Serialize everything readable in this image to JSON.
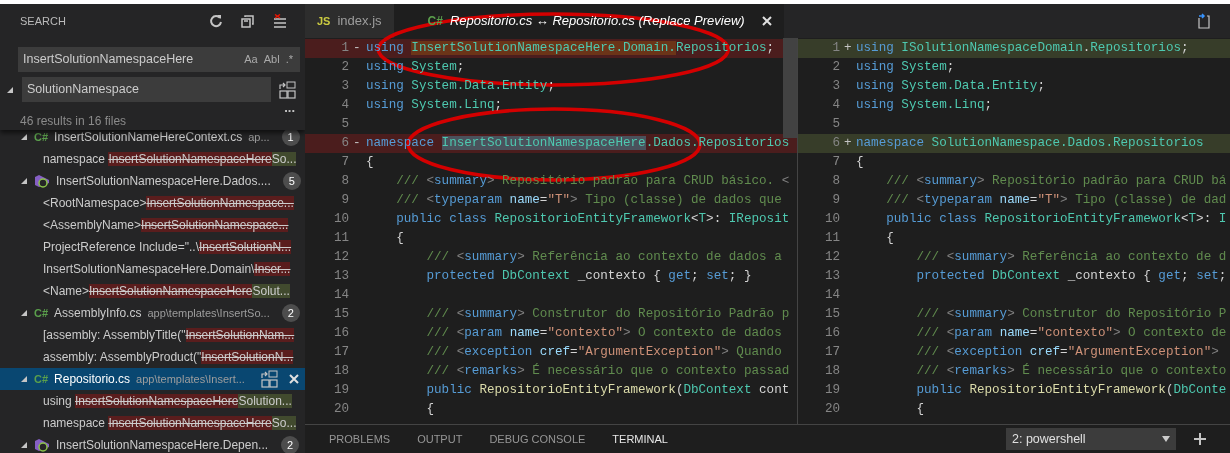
{
  "sidebar": {
    "title": "SEARCH",
    "find": {
      "value": "InsertSolutionNamespaceHere",
      "options": [
        "Aa",
        "Abl",
        ".*"
      ]
    },
    "replace": {
      "value": "SolutionNamespace",
      "expanded": true
    },
    "more": "...",
    "summary": "46 results in 16 files",
    "files": [
      {
        "kind": "csharp",
        "icon": "C#",
        "name": "InsertSolutionNameHereContext.cs",
        "path": "ap...",
        "count": "1",
        "expanded": true,
        "selected": false,
        "matches": [
          {
            "before": "namespace ",
            "removed": "InsertSolutionNamespaceHere",
            "added": "So..."
          }
        ]
      },
      {
        "kind": "project",
        "name": "InsertSolutionNamespaceHere.Dados....",
        "count": "5",
        "expanded": true,
        "selected": false,
        "matches": [
          {
            "before": "<RootNamespace>",
            "removed": "InsertSolutionNamespace..."
          },
          {
            "before": "<AssemblyName>",
            "removed": "InsertSolutionNamespace..."
          },
          {
            "before": "ProjectReference Include=\"..\\",
            "removed": "InsertSolutionN..."
          },
          {
            "before": "InsertSolutionNamespaceHere.Domain\\",
            "removed": "Inser..."
          },
          {
            "before": "<Name>",
            "removed": "InsertSolutionNamespaceHere",
            "added": "Solut..."
          }
        ]
      },
      {
        "kind": "csharp",
        "icon": "C#",
        "name": "AssemblyInfo.cs",
        "path": "app\\templates\\InsertSo...",
        "count": "2",
        "expanded": true,
        "selected": false,
        "matches": [
          {
            "before": "[assembly: AssemblyTitle(\"",
            "removed": "InsertSolutionNam..."
          },
          {
            "before": "assembly: AssemblyProduct(\"",
            "removed": "InsertSolutionN..."
          }
        ]
      },
      {
        "kind": "csharp",
        "icon": "C#",
        "name": "Repositorio.cs",
        "path": "app\\templates\\Insert...",
        "expanded": true,
        "selected": true,
        "matches": [
          {
            "before": "using ",
            "removed": "InsertSolutionNamespaceHere",
            "added": "Solution..."
          },
          {
            "before": "namespace ",
            "removed": "InsertSolutionNamespaceHere",
            "added": "So..."
          }
        ]
      },
      {
        "kind": "project",
        "name": "InsertSolutionNamespaceHere.Depen...",
        "count": "2",
        "expanded": true,
        "selected": false
      }
    ]
  },
  "tabs": [
    {
      "kind": "js",
      "icon": "JS",
      "label": "index.js",
      "selected": false,
      "preview": false
    },
    {
      "kind": "csharp",
      "icon": "C#",
      "label": "Repositorio.cs ↔ Repositorio.cs (Replace Preview)",
      "selected": true,
      "preview": true
    }
  ],
  "left_pane": {
    "lines": [
      {
        "number": "1",
        "marker": "-",
        "kind": "removed",
        "tokens": [
          {
            "text": "using ",
            "kind": "kw"
          },
          {
            "text": "InsertSolutionNamespaceHere.Domain.",
            "kind": "type",
            "changed": true,
            "circled": true
          },
          {
            "text": "Repositorios",
            "kind": "type"
          },
          {
            "text": ";",
            "kind": "plain"
          }
        ]
      },
      {
        "number": "2",
        "kind": "context",
        "tokens": [
          {
            "text": "using ",
            "kind": "kw"
          },
          {
            "text": "System",
            "kind": "type"
          },
          {
            "text": ";",
            "kind": "plain"
          }
        ]
      },
      {
        "number": "3",
        "kind": "context",
        "tokens": [
          {
            "text": "using ",
            "kind": "kw"
          },
          {
            "text": "System.Data.Entity",
            "kind": "type"
          },
          {
            "text": ";",
            "kind": "plain"
          }
        ]
      },
      {
        "number": "4",
        "kind": "context",
        "tokens": [
          {
            "text": "using ",
            "kind": "kw"
          },
          {
            "text": "System.Linq",
            "kind": "type"
          },
          {
            "text": ";",
            "kind": "plain"
          }
        ]
      },
      {
        "number": "5",
        "kind": "context"
      },
      {
        "number": "6",
        "marker": "-",
        "kind": "removed",
        "tokens": [
          {
            "text": "namespace ",
            "kind": "kw"
          },
          {
            "text": "InsertSolutionNamespaceHere",
            "kind": "type",
            "selected": true,
            "circled": true
          },
          {
            "text": ".Dados.Repositorios",
            "kind": "type"
          }
        ]
      },
      {
        "number": "7",
        "kind": "context",
        "tokens": [
          {
            "text": "{",
            "kind": "plain"
          }
        ]
      },
      {
        "number": "8",
        "kind": "context",
        "tokens": [
          {
            "text": "    ///",
            "kind": "comment"
          },
          {
            "text": " <",
            "kind": "delim"
          },
          {
            "text": "summary",
            "kind": "tag"
          },
          {
            "text": ">",
            "kind": "delim"
          },
          {
            "text": " Repositório padrão para CRUD básico. ",
            "kind": "comment"
          },
          {
            "text": "<",
            "kind": "delim"
          }
        ]
      },
      {
        "number": "9",
        "kind": "context",
        "tokens": [
          {
            "text": "    ///",
            "kind": "comment"
          },
          {
            "text": " <",
            "kind": "delim"
          },
          {
            "text": "typeparam ",
            "kind": "tag"
          },
          {
            "text": "name",
            "kind": "attr"
          },
          {
            "text": "=",
            "kind": "plain"
          },
          {
            "text": "\"T\"",
            "kind": "str"
          },
          {
            "text": ">",
            "kind": "delim"
          },
          {
            "text": " Tipo (classe) de dados que",
            "kind": "comment"
          }
        ]
      },
      {
        "number": "10",
        "kind": "context",
        "tokens": [
          {
            "text": "    public class ",
            "kind": "kw"
          },
          {
            "text": "RepositorioEntityFramework",
            "kind": "type"
          },
          {
            "text": "<",
            "kind": "plain"
          },
          {
            "text": "T",
            "kind": "type"
          },
          {
            "text": ">: ",
            "kind": "plain"
          },
          {
            "text": "IReposit",
            "kind": "type"
          }
        ]
      },
      {
        "number": "11",
        "kind": "context",
        "tokens": [
          {
            "text": "    {",
            "kind": "plain"
          }
        ]
      },
      {
        "number": "12",
        "kind": "context",
        "tokens": [
          {
            "text": "        ///",
            "kind": "comment"
          },
          {
            "text": " <",
            "kind": "delim"
          },
          {
            "text": "summary",
            "kind": "tag"
          },
          {
            "text": ">",
            "kind": "delim"
          },
          {
            "text": " Referência ao contexto de dados a",
            "kind": "comment"
          }
        ]
      },
      {
        "number": "13",
        "kind": "context",
        "tokens": [
          {
            "text": "        protected ",
            "kind": "kw"
          },
          {
            "text": "DbContext",
            "kind": "type"
          },
          {
            "text": " _contexto { ",
            "kind": "plain"
          },
          {
            "text": "get",
            "kind": "kw"
          },
          {
            "text": "; ",
            "kind": "plain"
          },
          {
            "text": "set",
            "kind": "kw"
          },
          {
            "text": "; }",
            "kind": "plain"
          }
        ]
      },
      {
        "number": "14",
        "kind": "context"
      },
      {
        "number": "15",
        "kind": "context",
        "tokens": [
          {
            "text": "        ///",
            "kind": "comment"
          },
          {
            "text": " <",
            "kind": "delim"
          },
          {
            "text": "summary",
            "kind": "tag"
          },
          {
            "text": ">",
            "kind": "delim"
          },
          {
            "text": " Construtor do Repositório Padrão p",
            "kind": "comment"
          }
        ]
      },
      {
        "number": "16",
        "kind": "context",
        "tokens": [
          {
            "text": "        ///",
            "kind": "comment"
          },
          {
            "text": " <",
            "kind": "delim"
          },
          {
            "text": "param ",
            "kind": "tag"
          },
          {
            "text": "name",
            "kind": "attr"
          },
          {
            "text": "=",
            "kind": "plain"
          },
          {
            "text": "\"contexto\"",
            "kind": "str"
          },
          {
            "text": ">",
            "kind": "delim"
          },
          {
            "text": " O contexto de dados",
            "kind": "comment"
          }
        ]
      },
      {
        "number": "17",
        "kind": "context",
        "tokens": [
          {
            "text": "        ///",
            "kind": "comment"
          },
          {
            "text": " <",
            "kind": "delim"
          },
          {
            "text": "exception ",
            "kind": "tag"
          },
          {
            "text": "cref",
            "kind": "attr"
          },
          {
            "text": "=",
            "kind": "plain"
          },
          {
            "text": "\"ArgumentException\"",
            "kind": "str"
          },
          {
            "text": ">",
            "kind": "delim"
          },
          {
            "text": " Quando",
            "kind": "comment"
          }
        ]
      },
      {
        "number": "18",
        "kind": "context",
        "tokens": [
          {
            "text": "        ///",
            "kind": "comment"
          },
          {
            "text": " <",
            "kind": "delim"
          },
          {
            "text": "remarks",
            "kind": "tag"
          },
          {
            "text": ">",
            "kind": "delim"
          },
          {
            "text": " É necessário que o contexto passad",
            "kind": "comment"
          }
        ]
      },
      {
        "number": "19",
        "kind": "context",
        "tokens": [
          {
            "text": "        public ",
            "kind": "kw"
          },
          {
            "text": "RepositorioEntityFramework",
            "kind": "fn"
          },
          {
            "text": "(",
            "kind": "plain"
          },
          {
            "text": "DbContext",
            "kind": "type"
          },
          {
            "text": " cont",
            "kind": "plain"
          }
        ]
      },
      {
        "number": "20",
        "kind": "context",
        "tokens": [
          {
            "text": "        {",
            "kind": "plain"
          }
        ]
      }
    ]
  },
  "right_pane": {
    "lines": [
      {
        "number": "1",
        "marker": "+",
        "kind": "added",
        "tokens": [
          {
            "text": "using ",
            "kind": "kw"
          },
          {
            "text": "ISolutionNamespaceDomain",
            "kind": "type"
          },
          {
            "text": ".",
            "kind": "plain"
          },
          {
            "text": "Repositorios",
            "kind": "type"
          },
          {
            "text": ";",
            "kind": "plain"
          }
        ]
      },
      {
        "number": "2",
        "kind": "context",
        "tokens": [
          {
            "text": "using ",
            "kind": "kw"
          },
          {
            "text": "System",
            "kind": "type"
          },
          {
            "text": ";",
            "kind": "plain"
          }
        ]
      },
      {
        "number": "3",
        "kind": "context",
        "tokens": [
          {
            "text": "using ",
            "kind": "kw"
          },
          {
            "text": "System.Data.Entity",
            "kind": "type"
          },
          {
            "text": ";",
            "kind": "plain"
          }
        ]
      },
      {
        "number": "4",
        "kind": "context",
        "tokens": [
          {
            "text": "using ",
            "kind": "kw"
          },
          {
            "text": "System.Linq",
            "kind": "type"
          },
          {
            "text": ";",
            "kind": "plain"
          }
        ]
      },
      {
        "number": "5",
        "kind": "context"
      },
      {
        "number": "6",
        "marker": "+",
        "kind": "added",
        "tokens": [
          {
            "text": "namespace ",
            "kind": "kw"
          },
          {
            "text": "SolutionNamespace.Dados.Repositorios",
            "kind": "type"
          }
        ]
      },
      {
        "number": "7",
        "kind": "context",
        "tokens": [
          {
            "text": "{",
            "kind": "plain"
          }
        ]
      },
      {
        "number": "8",
        "kind": "context",
        "tokens": [
          {
            "text": "    ///",
            "kind": "comment"
          },
          {
            "text": " <",
            "kind": "delim"
          },
          {
            "text": "summary",
            "kind": "tag"
          },
          {
            "text": ">",
            "kind": "delim"
          },
          {
            "text": " Repositório padrão para CRUD bá",
            "kind": "comment"
          }
        ]
      },
      {
        "number": "9",
        "kind": "context",
        "tokens": [
          {
            "text": "    ///",
            "kind": "comment"
          },
          {
            "text": " <",
            "kind": "delim"
          },
          {
            "text": "typeparam ",
            "kind": "tag"
          },
          {
            "text": "name",
            "kind": "attr"
          },
          {
            "text": "=",
            "kind": "plain"
          },
          {
            "text": "\"T\"",
            "kind": "str"
          },
          {
            "text": ">",
            "kind": "delim"
          },
          {
            "text": " Tipo (classe) de dad",
            "kind": "comment"
          }
        ]
      },
      {
        "number": "10",
        "kind": "context",
        "tokens": [
          {
            "text": "    public class ",
            "kind": "kw"
          },
          {
            "text": "RepositorioEntityFramework",
            "kind": "type"
          },
          {
            "text": "<",
            "kind": "plain"
          },
          {
            "text": "T",
            "kind": "type"
          },
          {
            "text": ">: ",
            "kind": "plain"
          },
          {
            "text": "I",
            "kind": "type"
          }
        ]
      },
      {
        "number": "11",
        "kind": "context",
        "tokens": [
          {
            "text": "    {",
            "kind": "plain"
          }
        ]
      },
      {
        "number": "12",
        "kind": "context",
        "tokens": [
          {
            "text": "        ///",
            "kind": "comment"
          },
          {
            "text": " <",
            "kind": "delim"
          },
          {
            "text": "summary",
            "kind": "tag"
          },
          {
            "text": ">",
            "kind": "delim"
          },
          {
            "text": " Referência ao contexto de d",
            "kind": "comment"
          }
        ]
      },
      {
        "number": "13",
        "kind": "context",
        "tokens": [
          {
            "text": "        protected ",
            "kind": "kw"
          },
          {
            "text": "DbContext",
            "kind": "type"
          },
          {
            "text": " _contexto { ",
            "kind": "plain"
          },
          {
            "text": "get",
            "kind": "kw"
          },
          {
            "text": "; ",
            "kind": "plain"
          },
          {
            "text": "set",
            "kind": "kw"
          },
          {
            "text": ";",
            "kind": "plain"
          }
        ]
      },
      {
        "number": "14",
        "kind": "context"
      },
      {
        "number": "15",
        "kind": "context",
        "tokens": [
          {
            "text": "        ///",
            "kind": "comment"
          },
          {
            "text": " <",
            "kind": "delim"
          },
          {
            "text": "summary",
            "kind": "tag"
          },
          {
            "text": ">",
            "kind": "delim"
          },
          {
            "text": " Construtor do Repositório P",
            "kind": "comment"
          }
        ]
      },
      {
        "number": "16",
        "kind": "context",
        "tokens": [
          {
            "text": "        ///",
            "kind": "comment"
          },
          {
            "text": " <",
            "kind": "delim"
          },
          {
            "text": "param ",
            "kind": "tag"
          },
          {
            "text": "name",
            "kind": "attr"
          },
          {
            "text": "=",
            "kind": "plain"
          },
          {
            "text": "\"contexto\"",
            "kind": "str"
          },
          {
            "text": ">",
            "kind": "delim"
          },
          {
            "text": " O contexto de",
            "kind": "comment"
          }
        ]
      },
      {
        "number": "17",
        "kind": "context",
        "tokens": [
          {
            "text": "        ///",
            "kind": "comment"
          },
          {
            "text": " <",
            "kind": "delim"
          },
          {
            "text": "exception ",
            "kind": "tag"
          },
          {
            "text": "cref",
            "kind": "attr"
          },
          {
            "text": "=",
            "kind": "plain"
          },
          {
            "text": "\"ArgumentException\"",
            "kind": "str"
          },
          {
            "text": ">",
            "kind": "delim"
          }
        ]
      },
      {
        "number": "18",
        "kind": "context",
        "tokens": [
          {
            "text": "        ///",
            "kind": "comment"
          },
          {
            "text": " <",
            "kind": "delim"
          },
          {
            "text": "remarks",
            "kind": "tag"
          },
          {
            "text": ">",
            "kind": "delim"
          },
          {
            "text": " É necessário que o contexto",
            "kind": "comment"
          }
        ]
      },
      {
        "number": "19",
        "kind": "context",
        "tokens": [
          {
            "text": "        public ",
            "kind": "kw"
          },
          {
            "text": "RepositorioEntityFramework",
            "kind": "fn"
          },
          {
            "text": "(",
            "kind": "plain"
          },
          {
            "text": "DbConte",
            "kind": "type"
          }
        ]
      },
      {
        "number": "20",
        "kind": "context",
        "tokens": [
          {
            "text": "        {",
            "kind": "plain"
          }
        ]
      }
    ]
  },
  "panel": {
    "tabs": [
      {
        "label": "PROBLEMS",
        "selected": false
      },
      {
        "label": "OUTPUT",
        "selected": false
      },
      {
        "label": "DEBUG CONSOLE",
        "selected": false
      },
      {
        "label": "TERMINAL",
        "selected": true
      }
    ],
    "terminal_select": "2: powershell"
  }
}
